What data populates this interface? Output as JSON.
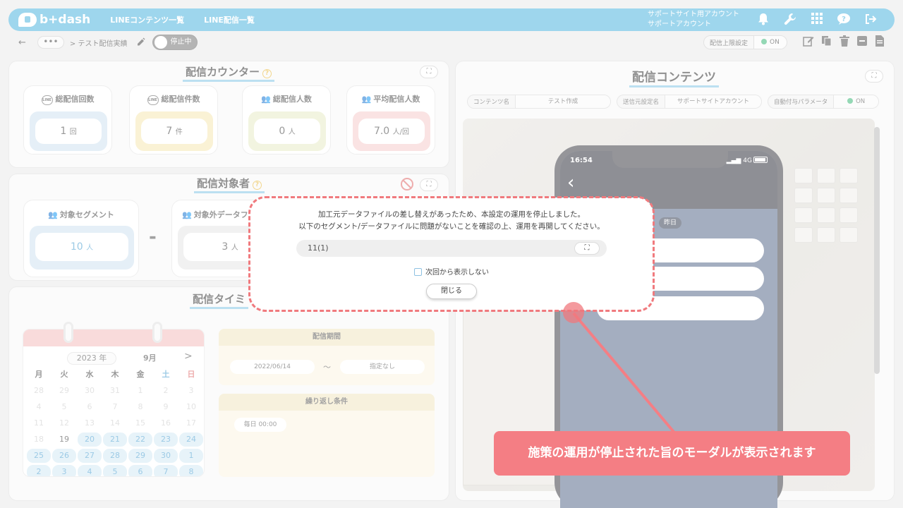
{
  "header": {
    "logo_text": "b+dash",
    "nav": [
      "LINEコンテンツ一覧",
      "LINE配信一覧"
    ],
    "account_line1": "サポートサイト用アカウント",
    "account_line2": "サポートアカウント"
  },
  "subbar": {
    "back": "←",
    "dots": "•••",
    "breadcrumb": "> テスト配信実績",
    "status_toggle": "停止中",
    "limit_label": "配信上限設定",
    "limit_value": "ON"
  },
  "counter": {
    "title": "配信カウンター",
    "cards": [
      {
        "label": "総配信回数",
        "value": "1",
        "unit": "回",
        "color": "#cfe2f1"
      },
      {
        "label": "総配信件数",
        "value": "7",
        "unit": "件",
        "color": "#f6e7b3"
      },
      {
        "label": "総配信人数",
        "value": "0",
        "unit": "人",
        "color": "#e8ecc6"
      },
      {
        "label": "平均配信人数",
        "value": "7.0",
        "unit": "人/回",
        "color": "#f6cccc"
      }
    ]
  },
  "target": {
    "title": "配信対象者",
    "segment_label": "対象セグメント",
    "segment_value": "10",
    "segment_unit": "人",
    "minus": "-",
    "excluded_label": "対象外データフ",
    "excluded_value": "3",
    "excluded_unit": "人"
  },
  "timing": {
    "title": "配信タイミ",
    "calendar": {
      "year": "2023 年",
      "month": "9月",
      "next": ">",
      "weekdays": [
        "月",
        "火",
        "水",
        "木",
        "金",
        "土",
        "日"
      ],
      "days": [
        [
          "28",
          "29",
          "30",
          "31",
          "1",
          "2",
          "3"
        ],
        [
          "4",
          "5",
          "6",
          "7",
          "8",
          "9",
          "10"
        ],
        [
          "11",
          "12",
          "13",
          "14",
          "15",
          "16",
          "17"
        ],
        [
          "18",
          "19",
          "20",
          "21",
          "22",
          "23",
          "24"
        ],
        [
          "25",
          "26",
          "27",
          "28",
          "29",
          "30",
          "1"
        ],
        [
          "2",
          "3",
          "4",
          "5",
          "6",
          "7",
          "8"
        ]
      ]
    },
    "period_title": "配信期間",
    "period_start": "2022/06/14",
    "period_sep": "～",
    "period_end": "指定なし",
    "repeat_title": "繰り返し条件",
    "repeat_value": "毎日 00:00"
  },
  "content": {
    "title": "配信コンテンツ",
    "name_label": "コンテンツ名",
    "name_value": "テスト作成",
    "sender_label": "送信元設定名",
    "sender_value": "サポートサイトアカウント",
    "param_label": "自動付与パラメータ",
    "param_value": "ON",
    "phone_time": "16:54",
    "phone_signal": "4G",
    "date_chip": "昨日"
  },
  "modal": {
    "line1": "加工元データファイルの差し替えがあったため、本設定の運用を停止しました。",
    "line2": "以下のセグメント/データファイルに問題がないことを確認の上、運用を再開してください。",
    "file_value": "11(1)",
    "checkbox_label": "次回から表示しない",
    "close_label": "閉じる"
  },
  "callout": {
    "text": "施策の運用が停止された旨のモーダルが表示されます",
    "color": "#f47e84"
  }
}
